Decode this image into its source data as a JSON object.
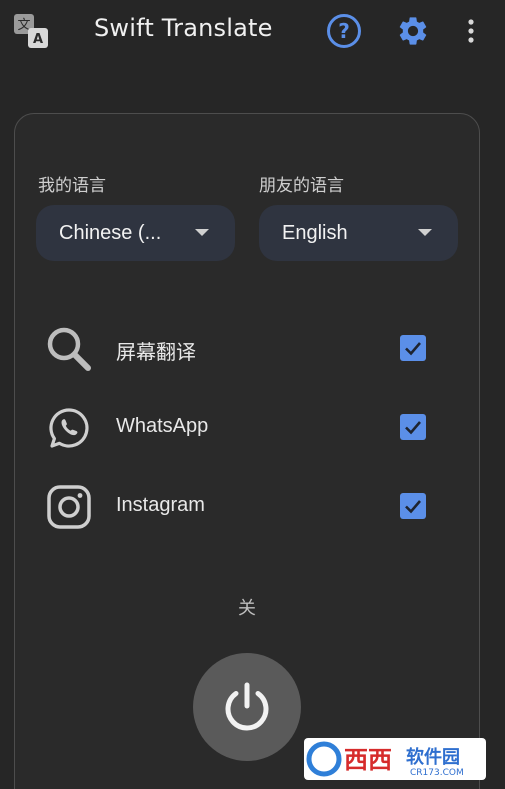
{
  "toolbar": {
    "title": "Swift Translate",
    "logo_icon": "translate-icon",
    "help_icon": "help-circle-icon",
    "settings_icon": "gear-icon",
    "more_icon": "more-vert-icon",
    "accent_color": "#5b8fe8"
  },
  "languages": {
    "my_label": "我的语言",
    "my_value": "Chinese (...",
    "friend_label": "朋友的语言",
    "friend_value": "English"
  },
  "features": [
    {
      "label": "屏幕翻译",
      "icon": "search-icon",
      "checked": true
    },
    {
      "label": "WhatsApp",
      "icon": "whatsapp-icon",
      "checked": true
    },
    {
      "label": "Instagram",
      "icon": "instagram-icon",
      "checked": true
    }
  ],
  "status": {
    "text": "关",
    "power_icon": "power-icon"
  },
  "watermark": {
    "text": "西西软件园",
    "subtext": "CR173.COM"
  }
}
